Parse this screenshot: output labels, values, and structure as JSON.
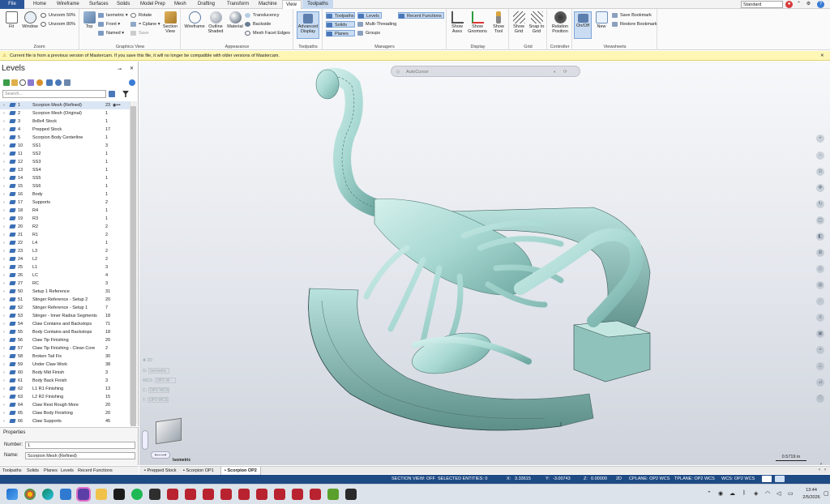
{
  "menu": {
    "tabs": [
      "File",
      "Home",
      "Wireframe",
      "Surfaces",
      "Solids",
      "Model Prep",
      "Mesh",
      "Drafting",
      "Transform",
      "Machine",
      "View",
      "Toolpaths"
    ],
    "active_tab": "View",
    "context_tab": "Toolpaths",
    "workspace": "Standard"
  },
  "ribbon": {
    "zoom": {
      "label": "Zoom",
      "fit": "Fit",
      "window": "Window",
      "unzoom50": "Unzoom 50%",
      "unzoom80": "Unzoom 80%"
    },
    "graphics_view": {
      "label": "Graphics View",
      "top": "Top",
      "isometric": "Isometric",
      "front": "Front",
      "named": "Named",
      "rotate": "Rotate",
      "cplane": "= Cplane",
      "save": "Save",
      "section_view": "Section View"
    },
    "appearance": {
      "label": "Appearance",
      "wireframe": "Wireframe",
      "outline_shaded": "Outline Shaded",
      "material": "Material",
      "translucency": "Translucency",
      "backside": "Backside",
      "mesh_facet_edges": "Mesh Facet Edges"
    },
    "toolpaths": {
      "label": "Toolpaths",
      "advanced_display": "Advanced Display"
    },
    "managers": {
      "label": "Managers",
      "toolpaths": "Toolpaths",
      "solids": "Solids",
      "planes": "Planes",
      "levels": "Levels",
      "multi_threading": "Multi-Threading",
      "groups": "Groups",
      "recent_functions": "Recent Functions"
    },
    "display": {
      "label": "Display",
      "show_axes": "Show Axes",
      "show_gnomons": "Show Gnomons",
      "show_tool": "Show Tool"
    },
    "grid": {
      "label": "Grid",
      "show_grid": "Show Grid",
      "snap_to_grid": "Snap to Grid"
    },
    "controller": {
      "label": "Controller",
      "relation_position": "Relation Position"
    },
    "viewsheets": {
      "label": "Viewsheets",
      "on_off": "On/Off",
      "new": "New",
      "save_bookmark": "Save Bookmark",
      "restore_bookmark": "Restore Bookmark"
    }
  },
  "notice": "Current file is from a previous version of Mastercam. If you save this file, it will no longer be compatible with older versions of Mastercam.",
  "levels_panel": {
    "title": "Levels",
    "search_placeholder": "Search...",
    "rows": [
      {
        "num": "1",
        "name": "Scorpion Mesh (Refined)",
        "count": "23"
      },
      {
        "num": "2",
        "name": "Scorpion Mesh (Original)",
        "count": "1"
      },
      {
        "num": "3",
        "name": "8x8x4 Stock",
        "count": "1"
      },
      {
        "num": "4",
        "name": "Prepped Stock",
        "count": "17"
      },
      {
        "num": "5",
        "name": "Scorpion Body Centerline",
        "count": "1"
      },
      {
        "num": "10",
        "name": "SS1",
        "count": "3"
      },
      {
        "num": "11",
        "name": "SS2",
        "count": "1"
      },
      {
        "num": "12",
        "name": "SS3",
        "count": "1"
      },
      {
        "num": "13",
        "name": "SS4",
        "count": "1"
      },
      {
        "num": "14",
        "name": "SS5",
        "count": "1"
      },
      {
        "num": "15",
        "name": "SS6",
        "count": "1"
      },
      {
        "num": "16",
        "name": "Body",
        "count": "1"
      },
      {
        "num": "17",
        "name": "Supports",
        "count": "2"
      },
      {
        "num": "18",
        "name": "R4",
        "count": "1"
      },
      {
        "num": "19",
        "name": "R3",
        "count": "1"
      },
      {
        "num": "20",
        "name": "R2",
        "count": "2"
      },
      {
        "num": "21",
        "name": "R1",
        "count": "2"
      },
      {
        "num": "22",
        "name": "L4",
        "count": "1"
      },
      {
        "num": "23",
        "name": "L3",
        "count": "2"
      },
      {
        "num": "24",
        "name": "L2",
        "count": "2"
      },
      {
        "num": "25",
        "name": "L1",
        "count": "3"
      },
      {
        "num": "26",
        "name": "LC",
        "count": "4"
      },
      {
        "num": "27",
        "name": "RC",
        "count": "3"
      },
      {
        "num": "50",
        "name": "Setup 1 Reference",
        "count": "31"
      },
      {
        "num": "51",
        "name": "Stinger Reference - Setup 2",
        "count": "20"
      },
      {
        "num": "52",
        "name": "Stinger Reference - Setup 1",
        "count": "7"
      },
      {
        "num": "53",
        "name": "Stinger - Inner Radius Segments",
        "count": "18"
      },
      {
        "num": "54",
        "name": "Claw Contains and Backstops",
        "count": "71"
      },
      {
        "num": "55",
        "name": "Body Contains and Backstops",
        "count": "18"
      },
      {
        "num": "56",
        "name": "Claw Tip Finishing",
        "count": "20"
      },
      {
        "num": "57",
        "name": "Claw Tip Finishing - Clean Core",
        "count": "2"
      },
      {
        "num": "58",
        "name": "Broken Tail Fix",
        "count": "30"
      },
      {
        "num": "59",
        "name": "Under Claw Work",
        "count": "38"
      },
      {
        "num": "60",
        "name": "Body Mid Finish",
        "count": "3"
      },
      {
        "num": "61",
        "name": "Body Back Finish",
        "count": "3"
      },
      {
        "num": "62",
        "name": "L1 R1 Finishing",
        "count": "13"
      },
      {
        "num": "63",
        "name": "L2 R2 Finishing",
        "count": "15"
      },
      {
        "num": "64",
        "name": "Claw Rest Rough More",
        "count": "20"
      },
      {
        "num": "65",
        "name": "Claw Body Finishing",
        "count": "20"
      },
      {
        "num": "66",
        "name": "Claw Supports",
        "count": "45"
      }
    ]
  },
  "properties": {
    "title": "Properties",
    "number_label": "Number:",
    "number_value": "1",
    "name_label": "Name:",
    "name_value": "Scorpion Mesh (Refined)"
  },
  "left_tabs": [
    "Toolpaths",
    "Solids",
    "Planes",
    "Levels",
    "Recent Functions"
  ],
  "viewport": {
    "toolbar_label": "AutoCursor",
    "overlay": {
      "mode": "2D",
      "g_label": "G:",
      "g_value": "Isometric",
      "wcs_label": "WCS:",
      "wcs_value": "OP2 W",
      "c_label": "C:",
      "c_value": "OP2 WCS",
      "t_label": "T:",
      "t_value": "OP2 WCS"
    },
    "view_name": "Isometric",
    "scale": "0.5719 in",
    "tabs": [
      "Prepped Stock",
      "Scorpion OP1",
      "Scorpion OP2"
    ],
    "active_tab": "Scorpion OP2"
  },
  "status": {
    "section_view": "SECTION VIEW: OFF",
    "selected": "SELECTED ENTITIES: 0",
    "x_label": "X:",
    "x": "3.33615",
    "y_label": "Y:",
    "y": "-3.00743",
    "z_label": "Z:",
    "z": "0.00000",
    "mode": "2D",
    "cplane": "CPLANE: OP2 WCS",
    "tplane": "TPLANE: OP2 WCS",
    "wcs": "WCS: OP2 WCS"
  },
  "taskbar": {
    "time": "13:44",
    "date": "2/5/2026"
  },
  "colors": {
    "accent": "#2b579a",
    "status_bar": "#1f4b85",
    "model": "#a8d8d2",
    "notice": "#fdf6b5"
  }
}
